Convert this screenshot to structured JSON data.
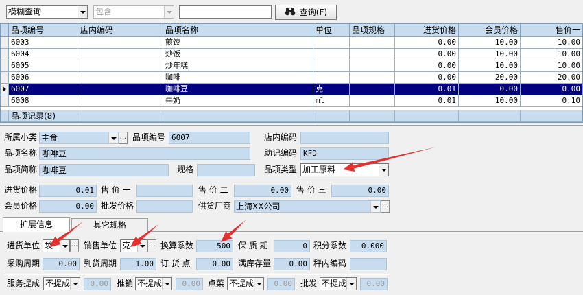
{
  "toolbar": {
    "mode_select": "模糊查询",
    "condition_select": "包含",
    "search_value": "",
    "query_button": "查询(F)"
  },
  "grid": {
    "columns": [
      "品项编号",
      "店内编码",
      "品项名称",
      "单位",
      "品项规格",
      "进货价格",
      "会员价格",
      "售价一"
    ],
    "rows": [
      [
        "6003",
        "",
        "煎饺",
        "",
        "",
        "0.00",
        "10.00",
        "10.00"
      ],
      [
        "6004",
        "",
        "炒饭",
        "",
        "",
        "0.00",
        "10.00",
        "10.00"
      ],
      [
        "6005",
        "",
        "炒年糕",
        "",
        "",
        "0.00",
        "10.00",
        "10.00"
      ],
      [
        "6006",
        "",
        "咖啡",
        "",
        "",
        "0.00",
        "20.00",
        "20.00"
      ],
      [
        "6007",
        "",
        "咖啡豆",
        "克",
        "",
        "0.01",
        "0.00",
        "0.00"
      ],
      [
        "6008",
        "",
        "牛奶",
        "ml",
        "",
        "0.01",
        "10.00",
        "0.10"
      ]
    ],
    "selected_index": 4,
    "footer": "品项记录(8)"
  },
  "form": {
    "subcategory_label": "所属小类",
    "subcategory_value": "主食",
    "code_label": "品项编号",
    "code_value": "6007",
    "store_code_label": "店内编码",
    "store_code_value": "",
    "name_label": "品项名称",
    "name_value": "咖啡豆",
    "mnemonic_label": "助记编码",
    "mnemonic_value": "KFD",
    "short_name_label": "品项简称",
    "short_name_value": "咖啡豆",
    "spec_label": "规格",
    "spec_value": "",
    "type_label": "品项类型",
    "type_value": "加工原料",
    "purchase_price_label": "进货价格",
    "purchase_price_value": "0.01",
    "price1_label": "售 价 一",
    "price1_value": "",
    "price2_label": "售 价 二",
    "price2_value": "0.00",
    "price3_label": "售 价 三",
    "price3_value": "0.00",
    "member_price_label": "会员价格",
    "member_price_value": "0.00",
    "wholesale_label": "批发价格",
    "wholesale_value": "",
    "supplier_label": "供货厂商",
    "supplier_value": "上海XX公司"
  },
  "tabs": [
    {
      "label": "扩展信息"
    },
    {
      "label": "其它规格"
    }
  ],
  "ext": {
    "purchase_unit_label": "进货单位",
    "purchase_unit_value": "袋",
    "sales_unit_label": "销售单位",
    "sales_unit_value": "克",
    "conversion_label": "换算系数",
    "conversion_value": "500",
    "shelf_life_label": "保 质 期",
    "shelf_life_value": "0",
    "points_label": "积分系数",
    "points_value": "0.000",
    "purchase_cycle_label": "采购周期",
    "purchase_cycle_value": "0.00",
    "arrival_cycle_label": "到货周期",
    "arrival_cycle_value": "1.00",
    "order_point_label": "订 货 点",
    "order_point_value": "0.00",
    "full_stock_label": "满库存量",
    "full_stock_value": "0.00",
    "storage_code_label": "秤内编码",
    "storage_code_value": "",
    "service_label": "服务提成",
    "service_value": "不提成",
    "service_amount": "0.00",
    "promo_label": "推销",
    "promo_value": "不提成",
    "promo_amount": "0.00",
    "order_label": "点菜",
    "order_value": "不提成",
    "order_amount": "0.00",
    "wholesale_label": "批发",
    "wholesale_value": "不提成",
    "wholesale_amount": "0.00"
  },
  "annotation_color": "#e53030"
}
